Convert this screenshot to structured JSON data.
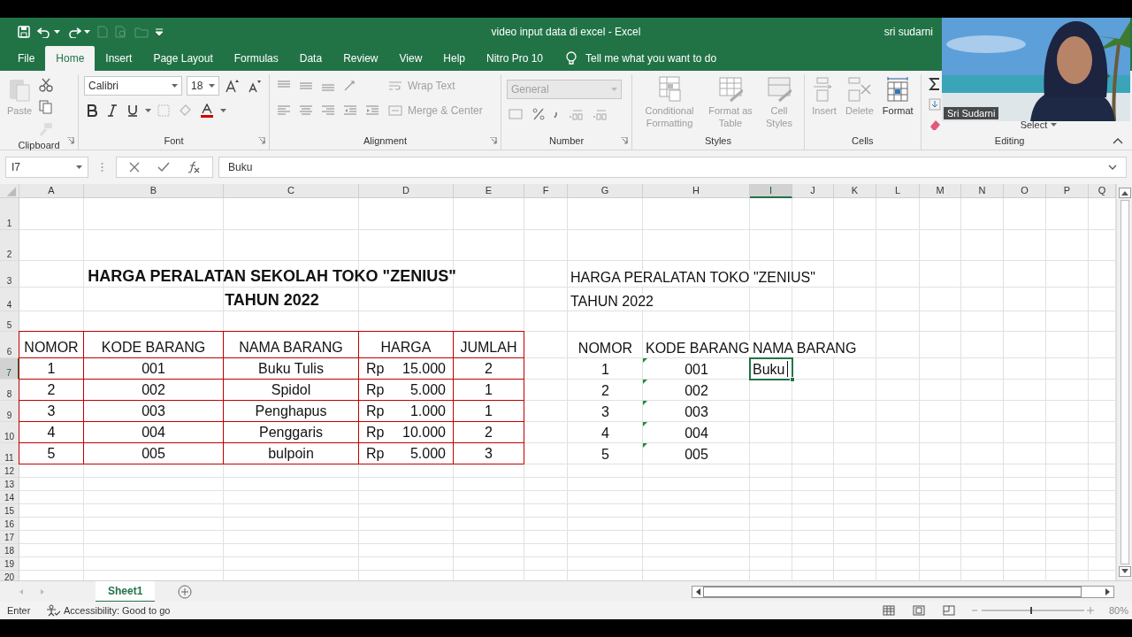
{
  "window": {
    "title": "video input data di excel  -  Excel",
    "user": "sri sudarni"
  },
  "tabs": [
    {
      "label": "File",
      "selected": false
    },
    {
      "label": "Home",
      "selected": true
    },
    {
      "label": "Insert",
      "selected": false
    },
    {
      "label": "Page Layout",
      "selected": false
    },
    {
      "label": "Formulas",
      "selected": false
    },
    {
      "label": "Data",
      "selected": false
    },
    {
      "label": "Review",
      "selected": false
    },
    {
      "label": "View",
      "selected": false
    },
    {
      "label": "Help",
      "selected": false
    },
    {
      "label": "Nitro Pro 10",
      "selected": false
    }
  ],
  "tell_me": "Tell me what you want to do",
  "ribbon": {
    "groups": [
      {
        "kind": "clipboard",
        "label": "Clipboard",
        "paste": {
          "label": "Paste",
          "disabled": true
        }
      },
      {
        "kind": "font",
        "label": "Font",
        "font": "Calibri",
        "size": "18"
      },
      {
        "kind": "alignment",
        "label": "Alignment",
        "wrap": "Wrap Text",
        "merge": "Merge & Center"
      },
      {
        "kind": "number",
        "label": "Number",
        "format": "General"
      },
      {
        "kind": "buttons",
        "label": "Styles",
        "buttons": [
          {
            "label": "Conditional Formatting",
            "disabled": true
          },
          {
            "label": "Format as Table",
            "disabled": true
          },
          {
            "label": "Cell Styles",
            "disabled": true
          }
        ]
      },
      {
        "kind": "buttons",
        "label": "Cells",
        "buttons": [
          {
            "label": "Insert",
            "disabled": true
          },
          {
            "label": "Delete",
            "disabled": true
          },
          {
            "label": "Format",
            "disabled": false
          }
        ]
      },
      {
        "kind": "editing",
        "label": "Editing",
        "select": "Select"
      }
    ]
  },
  "formula_bar": {
    "name_box": "I7",
    "formula": "Buku"
  },
  "columns": [
    {
      "label": "A",
      "selected": false
    },
    {
      "label": "B",
      "selected": false
    },
    {
      "label": "C",
      "selected": false
    },
    {
      "label": "D",
      "selected": false
    },
    {
      "label": "E",
      "selected": false
    },
    {
      "label": "F",
      "selected": false
    },
    {
      "label": "G",
      "selected": false
    },
    {
      "label": "H",
      "selected": false
    },
    {
      "label": "I",
      "selected": true
    },
    {
      "label": "J",
      "selected": false
    },
    {
      "label": "K",
      "selected": false
    },
    {
      "label": "L",
      "selected": false
    },
    {
      "label": "M",
      "selected": false
    },
    {
      "label": "N",
      "selected": false
    },
    {
      "label": "O",
      "selected": false
    },
    {
      "label": "P",
      "selected": false
    },
    {
      "label": "Q",
      "selected": false
    }
  ],
  "rows": [
    {
      "number": "1",
      "selected": false
    },
    {
      "number": "2",
      "selected": false
    },
    {
      "number": "3",
      "selected": false,
      "cells": [
        {
          "kind": "title",
          "text": "HARGA PERALATAN SEKOLAH TOKO \"ZENIUS\""
        },
        {
          "kind": "empty"
        },
        {
          "kind": "plain",
          "text": "HARGA PERALATAN TOKO \"ZENIUS\""
        }
      ]
    },
    {
      "number": "4",
      "selected": false,
      "cells": [
        {
          "kind": "title",
          "text": "TAHUN 2022"
        },
        {
          "kind": "empty"
        },
        {
          "kind": "plain",
          "text": "TAHUN 2022"
        }
      ]
    },
    {
      "number": "5",
      "selected": false
    },
    {
      "number": "6",
      "selected": false,
      "cells": [
        {
          "kind": "boxed",
          "text": "NOMOR"
        },
        {
          "kind": "boxed",
          "text": "KODE BARANG"
        },
        {
          "kind": "boxed",
          "text": "NAMA BARANG"
        },
        {
          "kind": "boxed",
          "text": "HARGA"
        },
        {
          "kind": "boxed",
          "text": "JUMLAH"
        },
        {
          "kind": "empty"
        },
        {
          "kind": "center",
          "text": "NOMOR"
        },
        {
          "kind": "plain",
          "text": "KODE BARANG"
        },
        {
          "kind": "plain",
          "text": "NAMA BARANG"
        }
      ]
    },
    {
      "number": "7",
      "selected": true,
      "cells": [
        {
          "kind": "boxed",
          "text": "1"
        },
        {
          "kind": "boxed",
          "text": "001"
        },
        {
          "kind": "boxed",
          "text": "Buku Tulis"
        },
        {
          "kind": "money",
          "prefix": "Rp",
          "text": "15.000"
        },
        {
          "kind": "boxed",
          "text": "2"
        },
        {
          "kind": "empty"
        },
        {
          "kind": "center",
          "text": "1"
        },
        {
          "kind": "textnum",
          "text": "001"
        },
        {
          "kind": "active",
          "text": "Buku"
        }
      ]
    },
    {
      "number": "8",
      "selected": false,
      "cells": [
        {
          "kind": "boxed",
          "text": "2"
        },
        {
          "kind": "boxed",
          "text": "002"
        },
        {
          "kind": "boxed",
          "text": "Spidol"
        },
        {
          "kind": "money",
          "prefix": "Rp",
          "text": "5.000"
        },
        {
          "kind": "boxed",
          "text": "1"
        },
        {
          "kind": "empty"
        },
        {
          "kind": "center",
          "text": "2"
        },
        {
          "kind": "textnum",
          "text": "002"
        }
      ]
    },
    {
      "number": "9",
      "selected": false,
      "cells": [
        {
          "kind": "boxed",
          "text": "3"
        },
        {
          "kind": "boxed",
          "text": "003"
        },
        {
          "kind": "boxed",
          "text": "Penghapus"
        },
        {
          "kind": "money",
          "prefix": "Rp",
          "text": "1.000"
        },
        {
          "kind": "boxed",
          "text": "1"
        },
        {
          "kind": "empty"
        },
        {
          "kind": "center",
          "text": "3"
        },
        {
          "kind": "textnum",
          "text": "003"
        }
      ]
    },
    {
      "number": "10",
      "selected": false,
      "cells": [
        {
          "kind": "boxed",
          "text": "4"
        },
        {
          "kind": "boxed",
          "text": "004"
        },
        {
          "kind": "boxed",
          "text": "Penggaris"
        },
        {
          "kind": "money",
          "prefix": "Rp",
          "text": "10.000"
        },
        {
          "kind": "boxed",
          "text": "2"
        },
        {
          "kind": "empty"
        },
        {
          "kind": "center",
          "text": "4"
        },
        {
          "kind": "textnum",
          "text": "004"
        }
      ]
    },
    {
      "number": "11",
      "selected": false,
      "cells": [
        {
          "kind": "boxed",
          "text": "5"
        },
        {
          "kind": "boxed",
          "text": "005"
        },
        {
          "kind": "boxed",
          "text": "bulpoin"
        },
        {
          "kind": "money",
          "prefix": "Rp",
          "text": "5.000"
        },
        {
          "kind": "boxed",
          "text": "3"
        },
        {
          "kind": "empty"
        },
        {
          "kind": "center",
          "text": "5"
        },
        {
          "kind": "textnum",
          "text": "005"
        }
      ]
    },
    {
      "number": "12",
      "selected": false
    },
    {
      "number": "13",
      "selected": false
    },
    {
      "number": "14",
      "selected": false
    },
    {
      "number": "15",
      "selected": false
    },
    {
      "number": "16",
      "selected": false
    },
    {
      "number": "17",
      "selected": false
    },
    {
      "number": "18",
      "selected": false
    },
    {
      "number": "19",
      "selected": false
    },
    {
      "number": "20",
      "selected": false
    }
  ],
  "sheet_tabs": [
    {
      "label": "Sheet1",
      "selected": true
    }
  ],
  "status_bar": {
    "mode": "Enter",
    "accessibility": "Accessibility: Good to go",
    "zoom": "80%"
  },
  "video_overlay": {
    "kind": "picture",
    "name_tag": "Sri Sudarni"
  }
}
